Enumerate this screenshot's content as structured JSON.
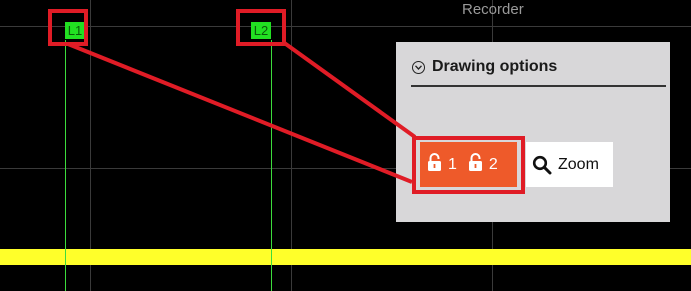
{
  "app": {
    "title": "Recorder"
  },
  "cursors": [
    {
      "label": "L1"
    },
    {
      "label": "L2"
    }
  ],
  "drawing_options": {
    "title": "Drawing options",
    "collapse_icon": "chevron-down-circle-icon",
    "lock_buttons": [
      {
        "label": "1",
        "icon": "unlock-icon"
      },
      {
        "label": "2",
        "icon": "unlock-icon"
      }
    ],
    "zoom_button": {
      "label": "Zoom",
      "icon": "magnifier-icon"
    }
  },
  "colors": {
    "background": "#000000",
    "grid": "#3a3a3a",
    "cursor": "#22e022",
    "trace": "#ffff2a",
    "lock_button": "#ee5a2a",
    "annotation": "#e01c26",
    "panel": "#d8d7d9"
  }
}
